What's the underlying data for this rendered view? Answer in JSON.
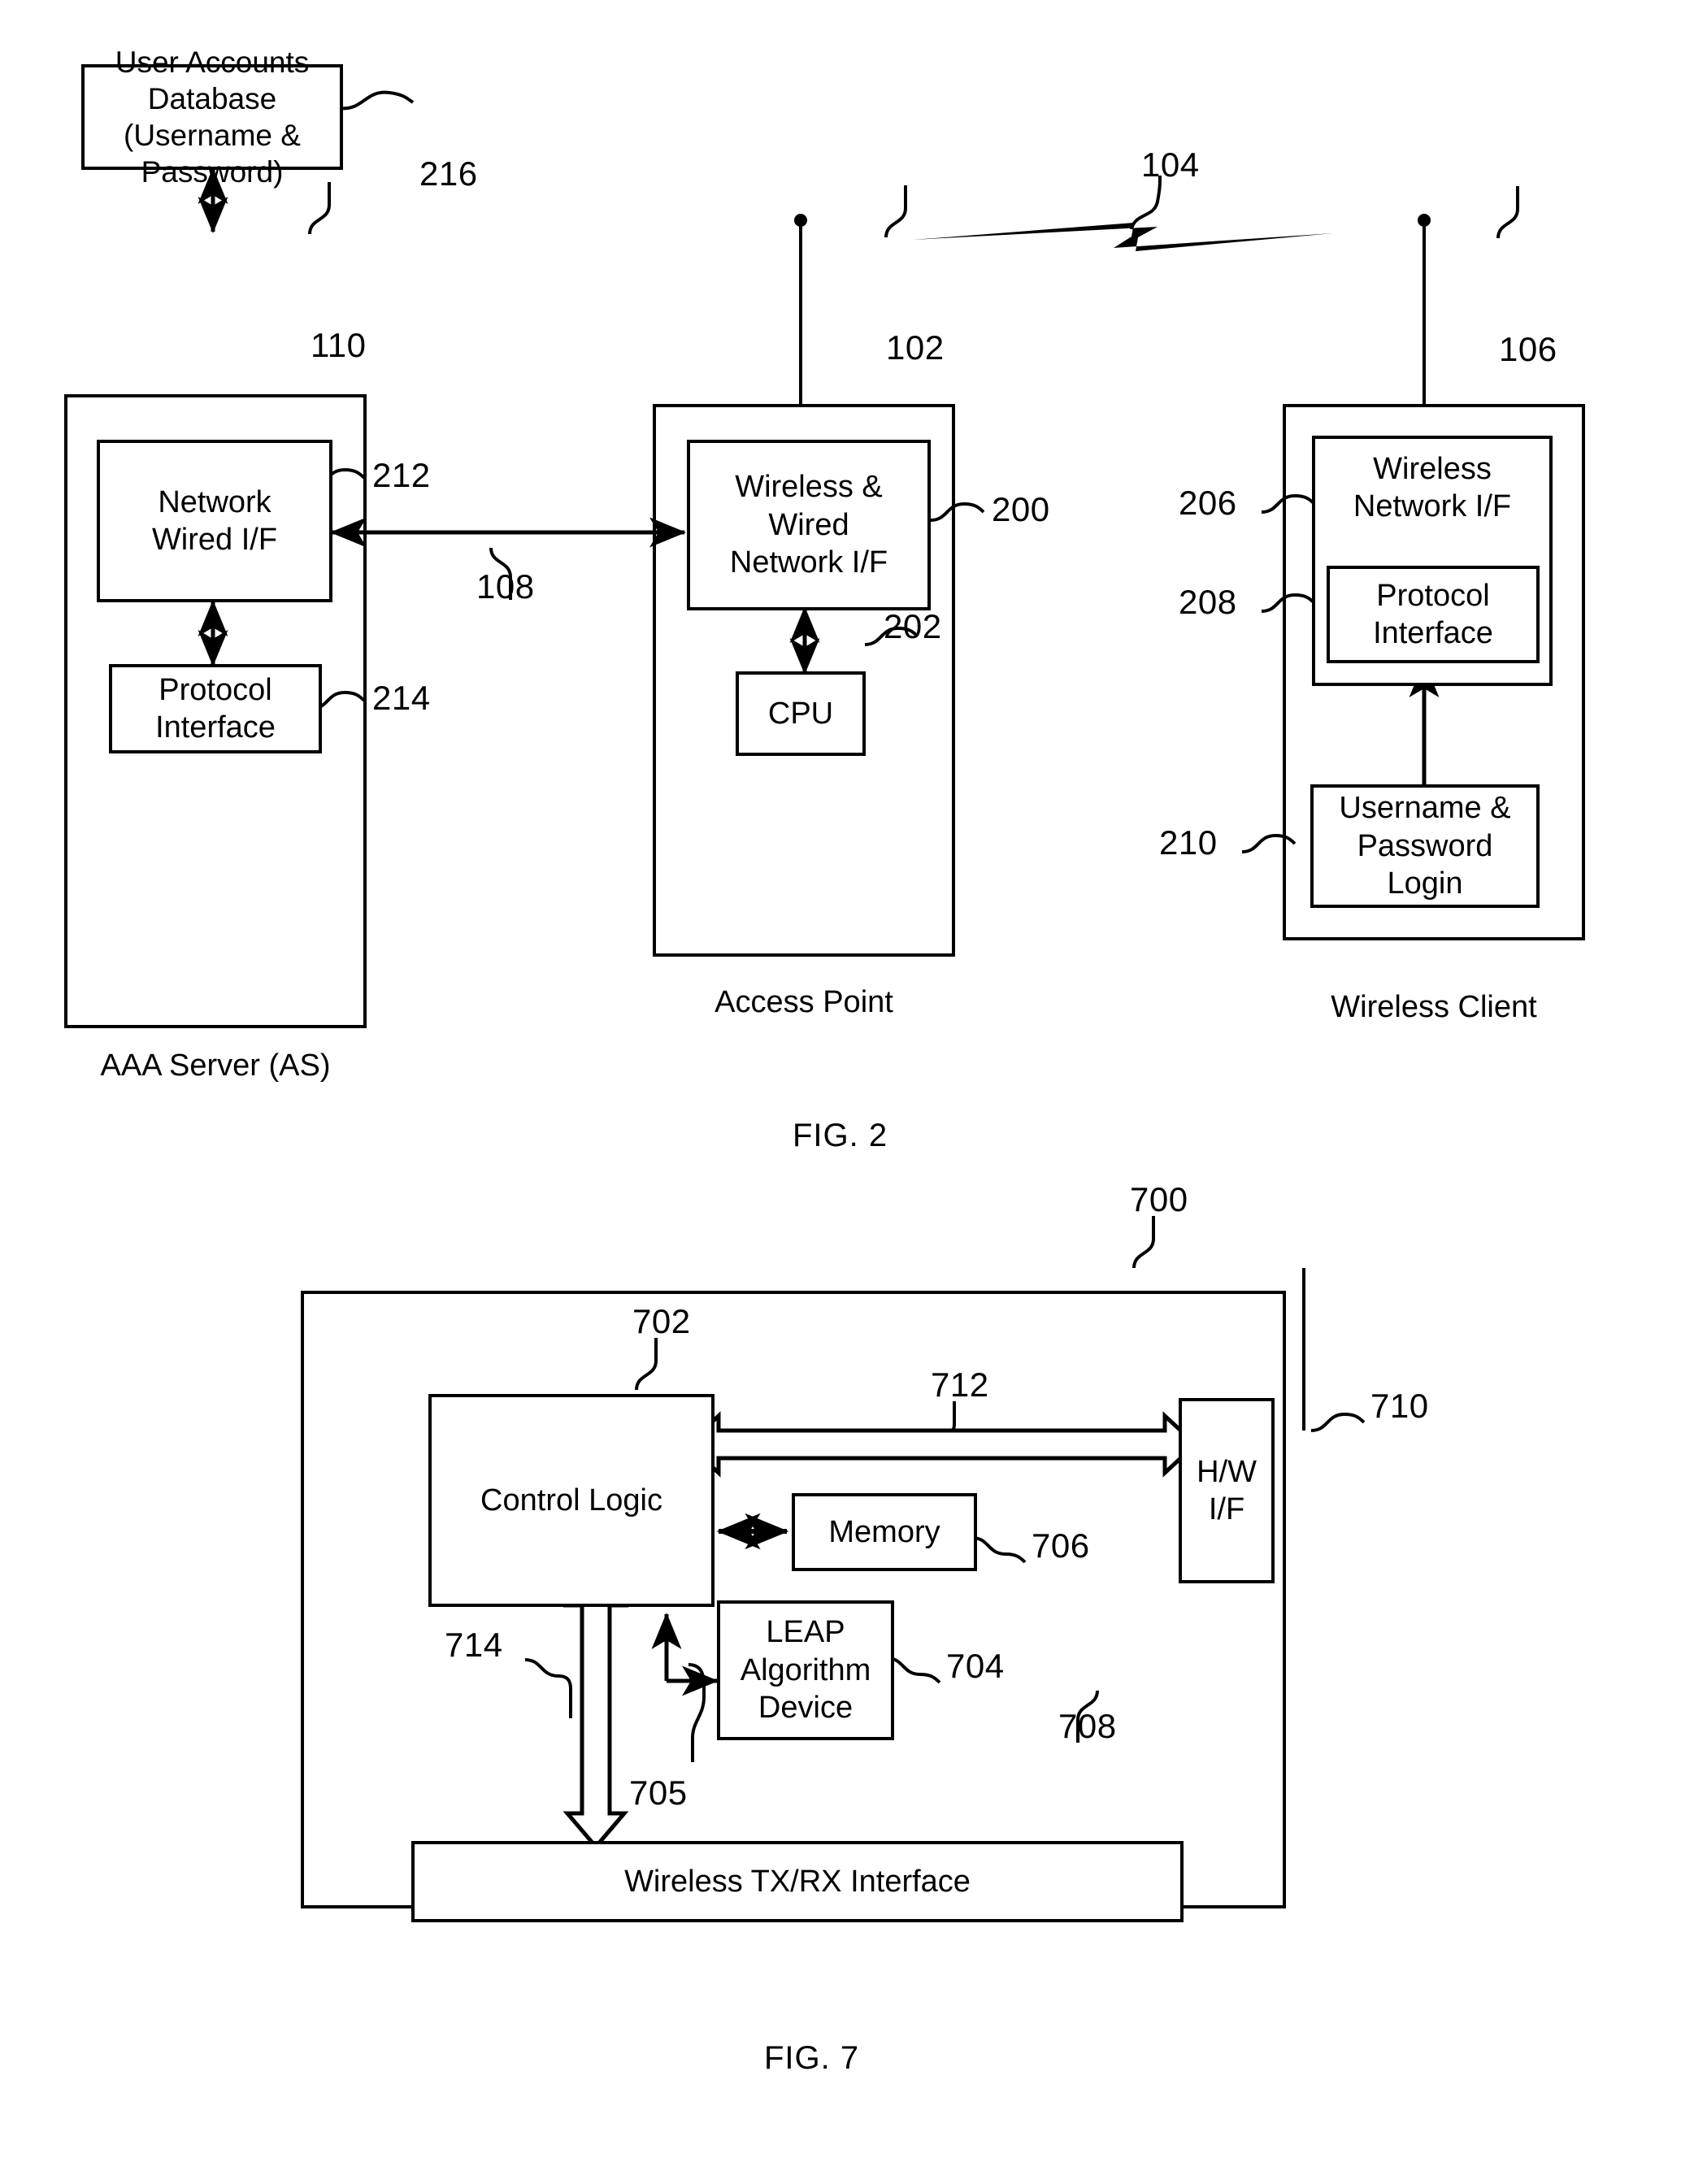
{
  "figures": [
    {
      "id": "fig2",
      "label": "FIG. 2",
      "nodes": {
        "user_accounts_db": "User Accounts\nDatabase\n(Username &\nPassword)",
        "network_wired_if": "Network\nWired I/F",
        "protocol_interface_as": "Protocol\nInterface",
        "wireless_wired_network_if": "Wireless &\nWired\nNetwork I/F",
        "cpu": "CPU",
        "wireless_network_if": "Wireless\nNetwork I/F",
        "protocol_interface_client": "Protocol\nInterface",
        "username_password_login": "Username &\nPassword\nLogin"
      },
      "captions": {
        "aaa_server": "AAA Server (AS)",
        "access_point": "Access Point",
        "wireless_client": "Wireless Client"
      },
      "refnums": {
        "db": "216",
        "aaa_server": "110",
        "network_wired_if": "212",
        "protocol_interface_as": "214",
        "wired_link": "108",
        "access_point": "102",
        "wireless_wired_network_if": "200",
        "cpu": "202",
        "wireless_link": "104",
        "wireless_client": "106",
        "wireless_network_if": "206",
        "protocol_interface_client": "208",
        "username_password_login": "210"
      }
    },
    {
      "id": "fig7",
      "label": "FIG. 7",
      "nodes": {
        "control_logic": "Control Logic",
        "memory": "Memory",
        "leap_algorithm_device": "LEAP\nAlgorithm\nDevice",
        "hw_if": "H/W\nI/F",
        "wireless_txrx_interface": "Wireless TX/RX Interface"
      },
      "refnums": {
        "device": "700",
        "control_logic": "702",
        "leap_algorithm_device": "704",
        "leap_link": "705",
        "memory": "706",
        "wireless_txrx_interface": "708",
        "hw_if": "710",
        "hw_bus": "712",
        "txrx_bus": "714"
      }
    }
  ]
}
